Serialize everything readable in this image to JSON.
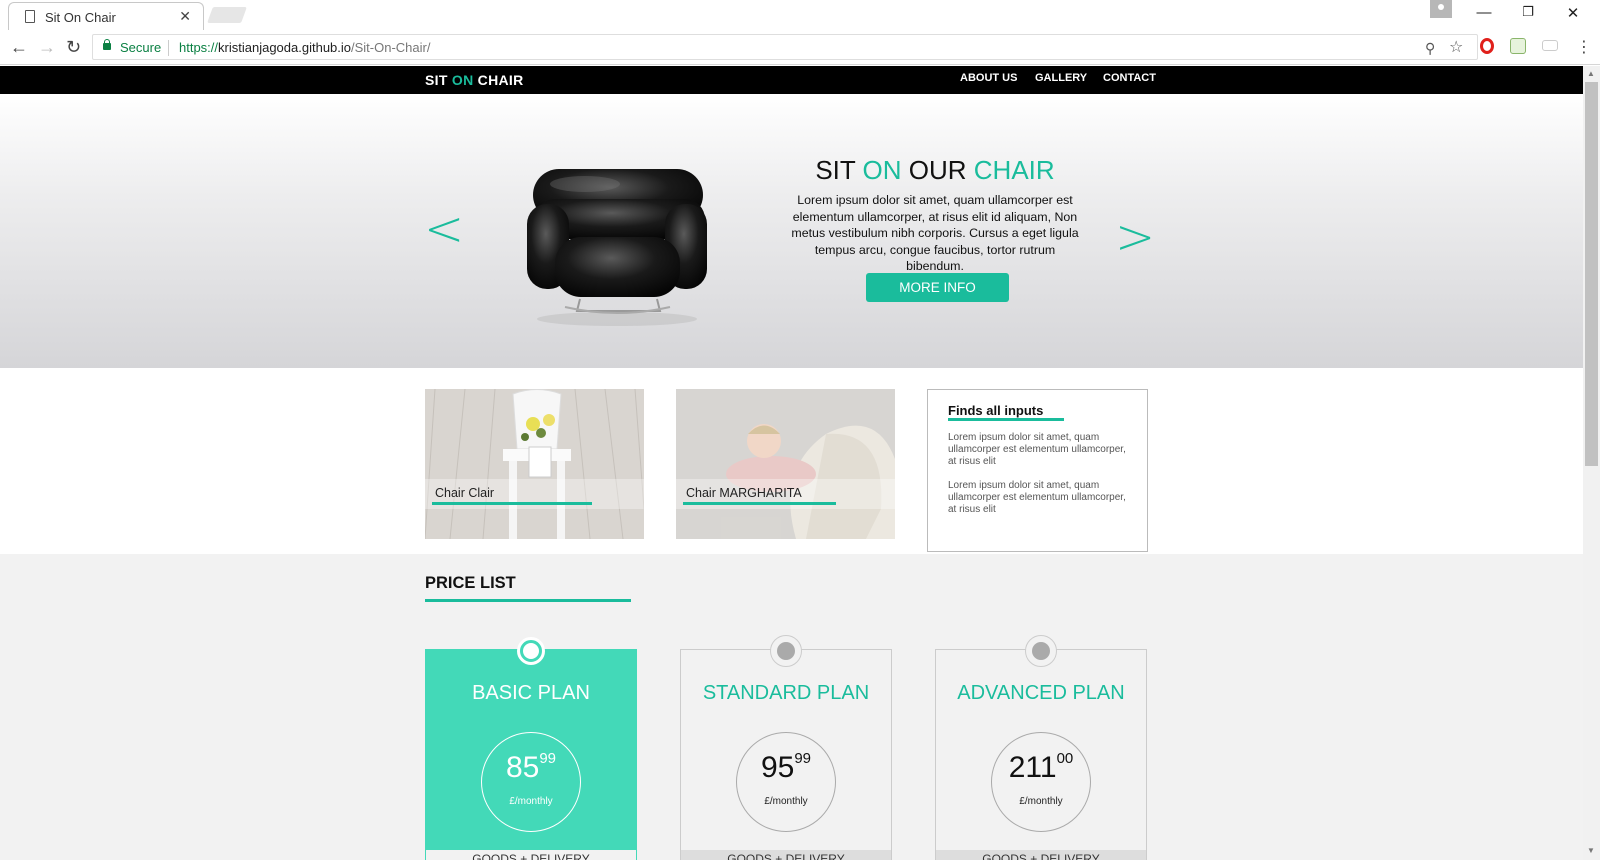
{
  "browser": {
    "tab_title": "Sit On Chair",
    "secure_label": "Secure",
    "url_scheme": "https://",
    "url_host": "kristianjagoda.github.io",
    "url_path": "/Sit-On-Chair/"
  },
  "site": {
    "logo": {
      "part1": "SIT ",
      "accent": "ON",
      "part2": " CHAIR"
    },
    "nav": [
      "ABOUT US",
      "GALLERY",
      "CONTACT"
    ]
  },
  "hero": {
    "title": {
      "w1": "SIT ",
      "w2": "ON",
      "w3": " OUR ",
      "w4": "CHAIR"
    },
    "text": "Lorem ipsum dolor sit amet, quam ullamcorper est elementum ullamcorper, at risus elit id aliquam, Non metus vestibulum nibh corporis. Cursus a eget ligula tempus arcu, congue faucibus, tortor rutrum bibendum.",
    "button": "MORE INFO",
    "prev": "<",
    "next": ">"
  },
  "cards": [
    {
      "label": "Chair Clair"
    },
    {
      "label": "Chair MARGHARITA"
    }
  ],
  "info_box": {
    "title": "Finds all inputs",
    "p1": "Lorem ipsum dolor sit amet, quam ullamcorper est elementum ullamcorper, at risus elit",
    "p2": "Lorem ipsum dolor sit amet, quam ullamcorper est elementum ullamcorper, at risus elit"
  },
  "pricing": {
    "heading": "PRICE LIST",
    "plans": [
      {
        "name": "BASIC PLAN",
        "price": "85",
        "cents": "99",
        "period": "£/monthly",
        "footer": "GOODS + DELIVERY"
      },
      {
        "name": "STANDARD PLAN",
        "price": "95",
        "cents": "99",
        "period": "£/monthly",
        "footer": "GOODS + DELIVERY"
      },
      {
        "name": "ADVANCED PLAN",
        "price": "211",
        "cents": "00",
        "period": "£/monthly",
        "footer": "GOODS + DELIVERY"
      }
    ]
  },
  "colors": {
    "accent": "#1abc9c",
    "active_plan": "#43d9b8",
    "navbar": "#000000",
    "secure_green": "#0b8043"
  }
}
